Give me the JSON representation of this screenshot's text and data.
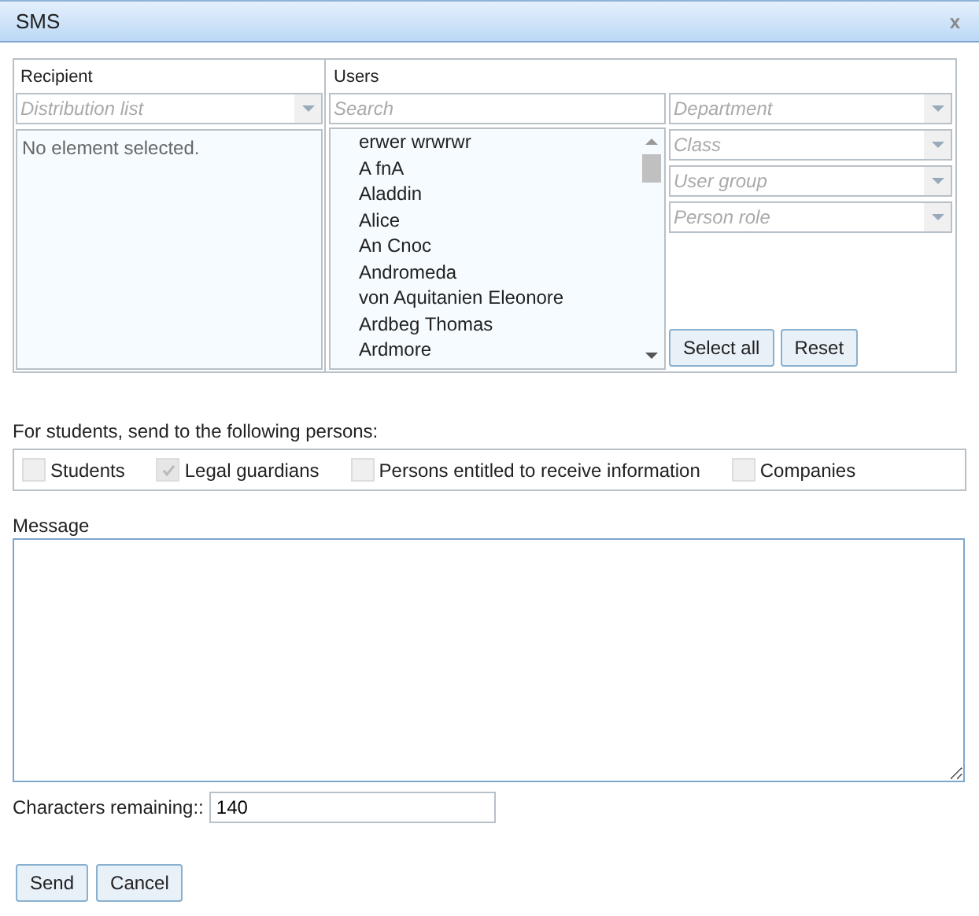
{
  "window": {
    "title": "SMS",
    "close": "x"
  },
  "recipient": {
    "label": "Recipient",
    "distribution_list": {
      "placeholder": "Distribution list"
    },
    "empty_text": "No element selected."
  },
  "users": {
    "label": "Users",
    "search": {
      "placeholder": "Search"
    },
    "items": [
      "erwer wrwrwr",
      "A fnA",
      "Aladdin",
      "Alice",
      "An Cnoc",
      "Andromeda",
      "von Aquitanien Eleonore",
      "Ardbeg Thomas",
      "Ardmore"
    ],
    "filters": [
      {
        "placeholder": "Department"
      },
      {
        "placeholder": "Class"
      },
      {
        "placeholder": "User group"
      },
      {
        "placeholder": "Person role"
      }
    ],
    "buttons": [
      "Select all",
      "Reset"
    ]
  },
  "persons": {
    "label": "For students, send to the following persons:",
    "options": [
      {
        "label": "Students",
        "checked": false
      },
      {
        "label": "Legal guardians",
        "checked": true
      },
      {
        "label": "Persons entitled to receive information",
        "checked": false
      },
      {
        "label": "Companies",
        "checked": false
      }
    ]
  },
  "message": {
    "label": "Message"
  },
  "characters_remaining": {
    "label": "Characters remaining::",
    "value": "140"
  },
  "buttons": [
    "Send",
    "Cancel"
  ]
}
